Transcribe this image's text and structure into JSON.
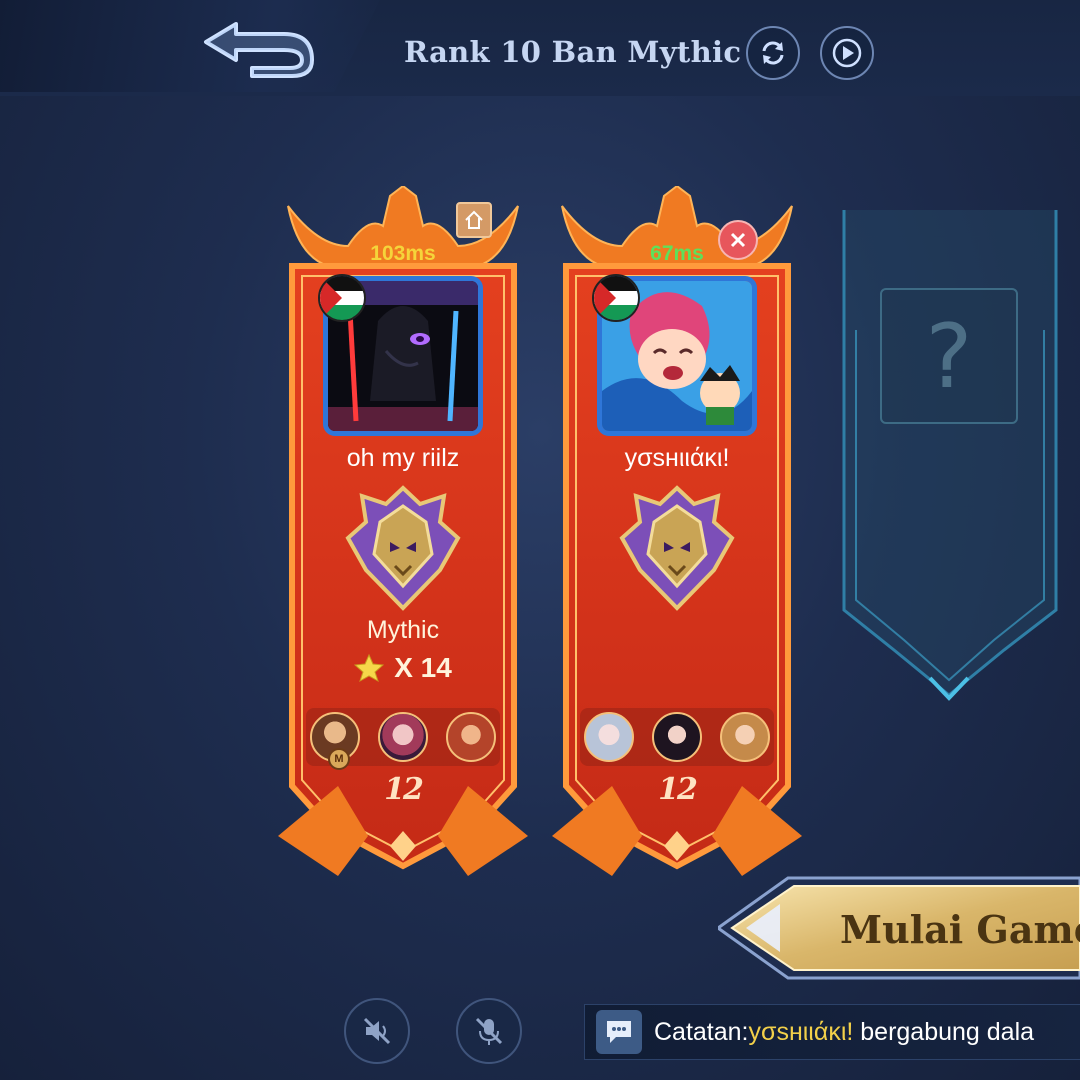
{
  "header": {
    "title": "Rank 10 Ban Mythic",
    "back_icon": "back-arrow-icon",
    "refresh_icon": "refresh-icon",
    "play_icon": "play-icon"
  },
  "players": [
    {
      "ping": "103ms",
      "ping_color": "#f5d43a",
      "name": "oh my riilz",
      "rank": "Mythic",
      "stars": "X 14",
      "level": "12",
      "flag": "palestine-flag-icon",
      "corner_icon": "home-icon",
      "hero_badge": "M"
    },
    {
      "ping": "67ms",
      "ping_color": "#5fe05a",
      "name": "yσѕнιιάκι!",
      "level": "12",
      "flag": "palestine-flag-icon",
      "corner_icon": "close-icon"
    }
  ],
  "empty_slot": {
    "symbol": "?"
  },
  "start_button": {
    "label": "Mulai Game"
  },
  "chat": {
    "prefix": "Catatan:",
    "highlight": "yσѕнιιάκι!",
    "suffix": " bergabung dala",
    "icon": "chat-bubble-icon"
  },
  "colors": {
    "banner_red": "#d8331a",
    "banner_orange": "#f27a1c",
    "gold": "#e8c877",
    "chat_highlight": "#f2d04a"
  }
}
